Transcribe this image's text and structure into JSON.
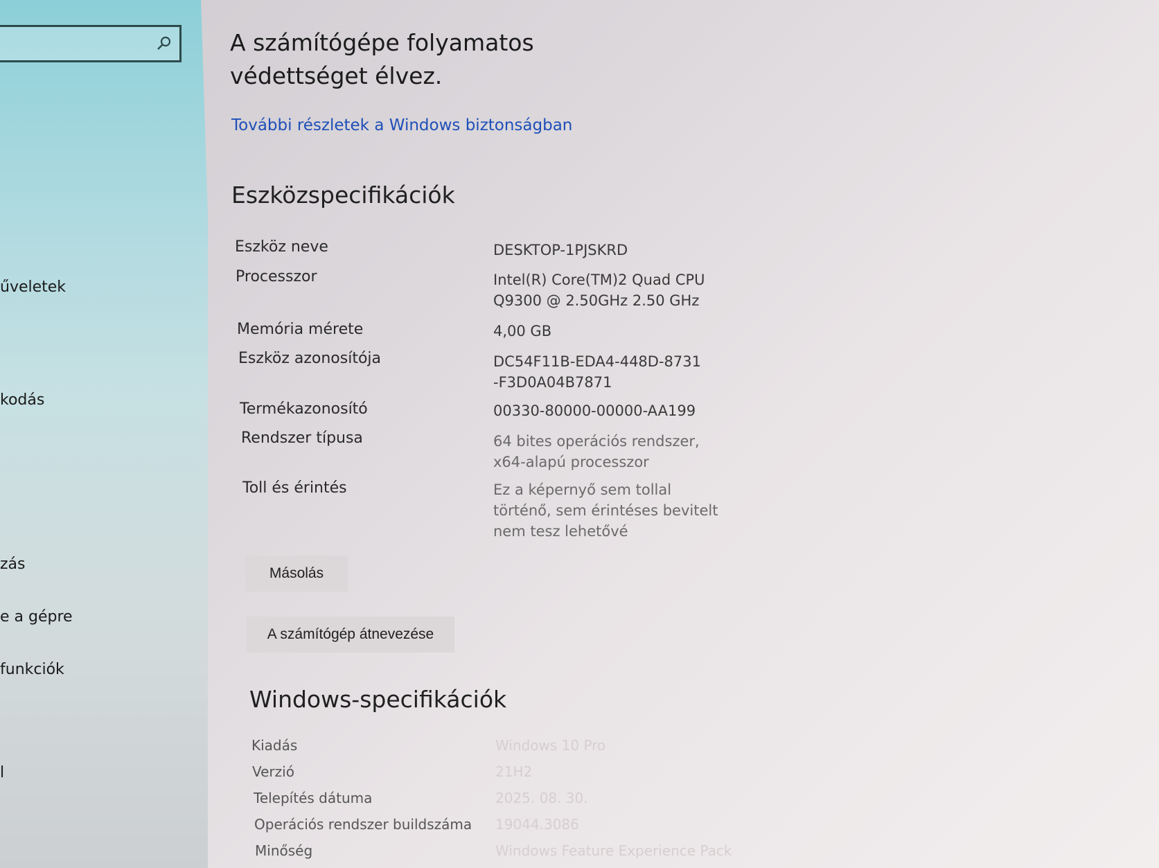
{
  "sidebar": {
    "search": {
      "value": ""
    },
    "items": [
      {
        "label": "űveletek"
      },
      {
        "label": "kodás"
      },
      {
        "label": "zás"
      },
      {
        "label": "e a gépre"
      },
      {
        "label": "funkciók"
      },
      {
        "label": "l"
      }
    ]
  },
  "security": {
    "status": "A számítógépe folyamatos védettséget élvez.",
    "link": "További részletek a Windows biztonságban"
  },
  "device_specs": {
    "title": "Eszközspecifikációk",
    "rows": [
      {
        "label": "Eszköz neve",
        "value": "DESKTOP-1PJSKRD"
      },
      {
        "label": "Processzor",
        "value": "Intel(R) Core(TM)2 Quad  CPU Q9300  @ 2.50GHz   2.50 GHz"
      },
      {
        "label": "Memória mérete",
        "value": "4,00 GB"
      },
      {
        "label": "Eszköz azonosítója",
        "value": "DC54F11B-EDA4-448D-8731-F3D0A04B7871"
      },
      {
        "label": "Termékazonosító",
        "value": "00330-80000-00000-AA199"
      },
      {
        "label": "Rendszer típusa",
        "value": "64 bites operációs rendszer, x64-alapú processzor"
      },
      {
        "label": "Toll és érintés",
        "value": "Ez a képernyő sem tollal történő, sem érintéses bevitelt nem tesz lehetővé"
      }
    ],
    "copy_button": "Másolás",
    "rename_button": "A számítógép átnevezése"
  },
  "windows_specs": {
    "title": "Windows-specifikációk",
    "rows": [
      {
        "label": "Kiadás",
        "value": "Windows 10 Pro"
      },
      {
        "label": "Verzió",
        "value": "21H2"
      },
      {
        "label": "Telepítés dátuma",
        "value": "2025. 08. 30."
      },
      {
        "label": "Operációs rendszer buildszáma",
        "value": "19044.3086"
      },
      {
        "label": "Minőség",
        "value": "Windows Feature Experience Pack"
      }
    ]
  }
}
